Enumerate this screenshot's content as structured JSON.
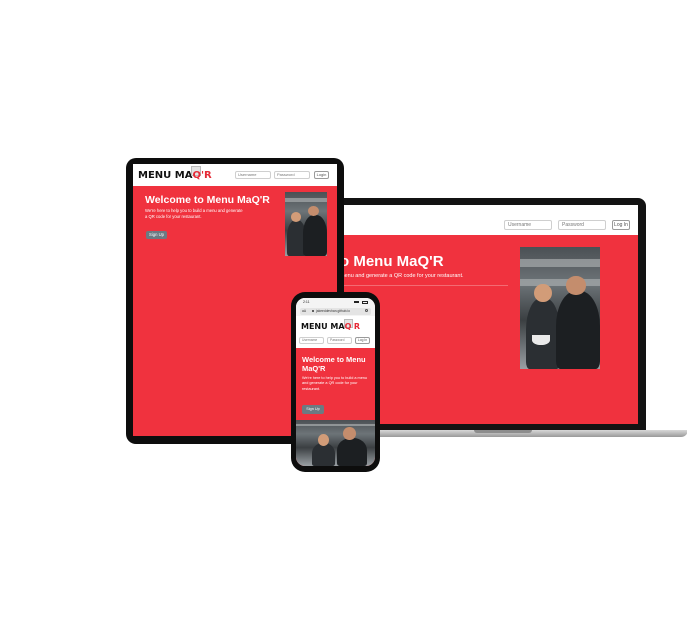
{
  "app": {
    "name_part1": "MENU MA",
    "name_q": "Q",
    "name_r": "'R",
    "title": "Welcome to Menu MaQ'R",
    "description": "We're here to help you to build a menu and generate a QR code for your restaurant.",
    "laptop_title_visible": "o Menu MaQ'R",
    "laptop_desc_visible": "menu and generate a QR code for your restaurant.",
    "phone_title_line1": "Welcome to Menu",
    "phone_title_line2": "MaQ'R"
  },
  "login": {
    "username_placeholder": "Username",
    "password_placeholder": "Password",
    "login_label": "Log In",
    "login_label_tablet": "Login"
  },
  "signup_label": "Sign Up",
  "phone_status": {
    "time": "2:11",
    "url": "jakeeddevhan.github.io",
    "aa": "aA"
  },
  "colors": {
    "brand_red": "#f0323e",
    "button_grey": "#6c7a82"
  },
  "icons": [
    "qr-code-icon",
    "lock-icon",
    "reload-icon",
    "signal-icon",
    "battery-icon"
  ]
}
